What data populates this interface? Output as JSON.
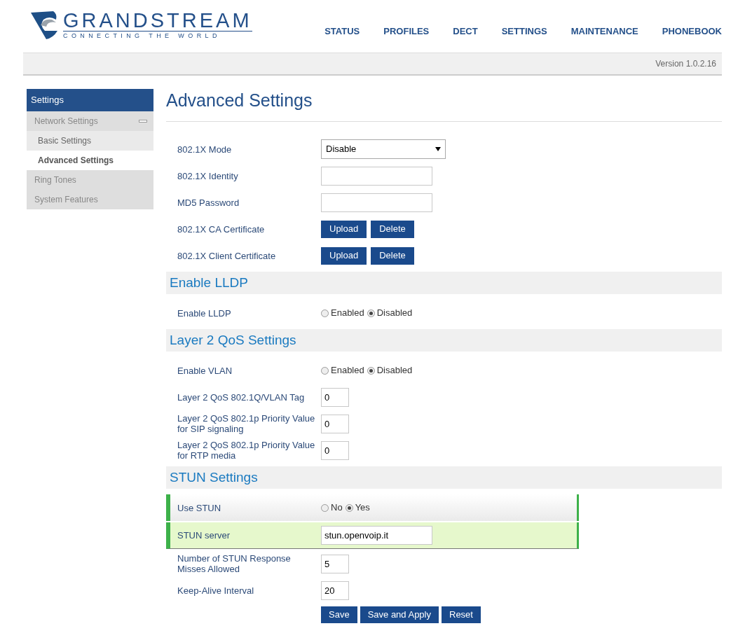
{
  "header": {
    "brand": "GRANDSTREAM",
    "tagline": "CONNECTING THE WORLD",
    "nav": [
      {
        "label": "STATUS"
      },
      {
        "label": "PROFILES"
      },
      {
        "label": "DECT"
      },
      {
        "label": "SETTINGS"
      },
      {
        "label": "MAINTENANCE"
      },
      {
        "label": "PHONEBOOK"
      }
    ],
    "version": "Version 1.0.2.16"
  },
  "sidebar": {
    "title": "Settings",
    "items": [
      {
        "label": "Network Settings",
        "expanded": true,
        "children": [
          {
            "label": "Basic Settings",
            "selected": false
          },
          {
            "label": "Advanced Settings",
            "selected": true
          }
        ]
      },
      {
        "label": "Ring Tones",
        "expanded": false
      },
      {
        "label": "System Features",
        "expanded": false
      }
    ]
  },
  "page_title": "Advanced Settings",
  "sections": [
    {
      "rows": [
        {
          "kind": "select",
          "label": "802.1X Mode",
          "value": "Disable"
        },
        {
          "kind": "text",
          "label": "802.1X Identity",
          "value": ""
        },
        {
          "kind": "text",
          "label": "MD5 Password",
          "value": ""
        },
        {
          "kind": "buttons",
          "label": "802.1X CA Certificate",
          "buttons": [
            "Upload",
            "Delete"
          ]
        },
        {
          "kind": "buttons",
          "label": "802.1X Client Certificate",
          "buttons": [
            "Upload",
            "Delete"
          ]
        }
      ]
    },
    {
      "title": "Enable LLDP",
      "rows": [
        {
          "kind": "radio",
          "label": "Enable LLDP",
          "options": [
            {
              "label": "Enabled",
              "selected": false
            },
            {
              "label": "Disabled",
              "selected": true
            }
          ]
        }
      ]
    },
    {
      "title": "Layer 2 QoS Settings",
      "rows": [
        {
          "kind": "radio",
          "label": "Enable VLAN",
          "options": [
            {
              "label": "Enabled",
              "selected": false
            },
            {
              "label": "Disabled",
              "selected": true
            }
          ]
        },
        {
          "kind": "small",
          "label": "Layer 2 QoS 802.1Q/VLAN Tag",
          "value": "0"
        },
        {
          "kind": "small",
          "label": "Layer 2 QoS 802.1p Priority Value for SIP signaling",
          "value": "0"
        },
        {
          "kind": "small",
          "label": "Layer 2 QoS 802.1p Priority Value for RTP media",
          "value": "0"
        }
      ]
    },
    {
      "title": "STUN Settings",
      "rows": [
        {
          "kind": "radio",
          "label": "Use STUN",
          "highlighted": true,
          "focused": false,
          "options": [
            {
              "label": "No",
              "selected": false
            },
            {
              "label": "Yes",
              "selected": true
            }
          ]
        },
        {
          "kind": "text",
          "label": "STUN server",
          "value": "stun.openvoip.it",
          "highlighted": true,
          "focused": true
        },
        {
          "kind": "small",
          "label": "Number of STUN Response Misses Allowed",
          "value": "5"
        },
        {
          "kind": "small",
          "label": "Keep-Alive Interval",
          "value": "20"
        }
      ]
    }
  ],
  "actions": [
    "Save",
    "Save and Apply",
    "Reset"
  ]
}
